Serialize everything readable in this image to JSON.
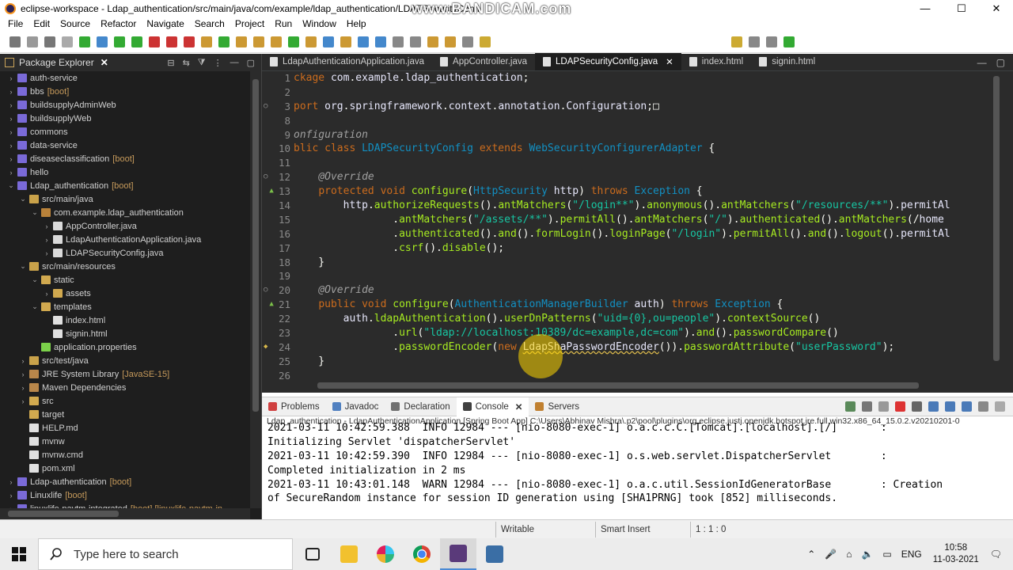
{
  "window": {
    "title": "eclipse-workspace - Ldap_authentication/src/main/java/com/example/ldap_authentication/LDAPSecurityConfi",
    "watermark": "www.BANDICAM.com",
    "controls": {
      "minimize": "—",
      "maximize": "☐",
      "close": "✕"
    }
  },
  "menu": [
    "File",
    "Edit",
    "Source",
    "Refactor",
    "Navigate",
    "Search",
    "Project",
    "Run",
    "Window",
    "Help"
  ],
  "explorer": {
    "title": "Package Explorer",
    "items": [
      {
        "label": "auth-service",
        "suffix": "",
        "depth": 0,
        "arrow": "›",
        "icon": "project-icon"
      },
      {
        "label": "bbs",
        "suffix": "[boot]",
        "depth": 0,
        "arrow": "›",
        "icon": "project-icon"
      },
      {
        "label": "buildsupplyAdminWeb",
        "suffix": "",
        "depth": 0,
        "arrow": "›",
        "icon": "project-icon"
      },
      {
        "label": "buildsupplyWeb",
        "suffix": "",
        "depth": 0,
        "arrow": "›",
        "icon": "project-icon"
      },
      {
        "label": "commons",
        "suffix": "",
        "depth": 0,
        "arrow": "›",
        "icon": "project-icon"
      },
      {
        "label": "data-service",
        "suffix": "",
        "depth": 0,
        "arrow": "›",
        "icon": "project-icon"
      },
      {
        "label": "diseaseclassification",
        "suffix": "[boot]",
        "depth": 0,
        "arrow": "›",
        "icon": "project-icon"
      },
      {
        "label": "hello",
        "suffix": "",
        "depth": 0,
        "arrow": "›",
        "icon": "project-icon"
      },
      {
        "label": "Ldap_authentication",
        "suffix": "[boot]",
        "depth": 0,
        "arrow": "⌄",
        "icon": "project-icon"
      },
      {
        "label": "src/main/java",
        "suffix": "",
        "depth": 1,
        "arrow": "⌄",
        "icon": "source-folder-icon"
      },
      {
        "label": "com.example.ldap_authentication",
        "suffix": "",
        "depth": 2,
        "arrow": "⌄",
        "icon": "package-icon"
      },
      {
        "label": "AppController.java",
        "suffix": "",
        "depth": 3,
        "arrow": "›",
        "icon": "java-file-icon"
      },
      {
        "label": "LdapAuthenticationApplication.java",
        "suffix": "",
        "depth": 3,
        "arrow": "›",
        "icon": "java-file-icon"
      },
      {
        "label": "LDAPSecurityConfig.java",
        "suffix": "",
        "depth": 3,
        "arrow": "›",
        "icon": "java-file-icon"
      },
      {
        "label": "src/main/resources",
        "suffix": "",
        "depth": 1,
        "arrow": "⌄",
        "icon": "source-folder-icon"
      },
      {
        "label": "static",
        "suffix": "",
        "depth": 2,
        "arrow": "⌄",
        "icon": "folder-icon"
      },
      {
        "label": "assets",
        "suffix": "",
        "depth": 3,
        "arrow": "›",
        "icon": "folder-icon"
      },
      {
        "label": "templates",
        "suffix": "",
        "depth": 2,
        "arrow": "⌄",
        "icon": "folder-icon"
      },
      {
        "label": "index.html",
        "suffix": "",
        "depth": 3,
        "arrow": "",
        "icon": "html-file-icon"
      },
      {
        "label": "signin.html",
        "suffix": "",
        "depth": 3,
        "arrow": "",
        "icon": "html-file-icon"
      },
      {
        "label": "application.properties",
        "suffix": "",
        "depth": 2,
        "arrow": "",
        "icon": "properties-file-icon"
      },
      {
        "label": "src/test/java",
        "suffix": "",
        "depth": 1,
        "arrow": "›",
        "icon": "source-folder-icon"
      },
      {
        "label": "JRE System Library",
        "suffix": "[JavaSE-15]",
        "depth": 1,
        "arrow": "›",
        "icon": "library-icon"
      },
      {
        "label": "Maven Dependencies",
        "suffix": "",
        "depth": 1,
        "arrow": "›",
        "icon": "library-icon"
      },
      {
        "label": "src",
        "suffix": "",
        "depth": 1,
        "arrow": "›",
        "icon": "folder-icon"
      },
      {
        "label": "target",
        "suffix": "",
        "depth": 1,
        "arrow": "",
        "icon": "folder-icon"
      },
      {
        "label": "HELP.md",
        "suffix": "",
        "depth": 1,
        "arrow": "",
        "icon": "file-icon"
      },
      {
        "label": "mvnw",
        "suffix": "",
        "depth": 1,
        "arrow": "",
        "icon": "file-icon"
      },
      {
        "label": "mvnw.cmd",
        "suffix": "",
        "depth": 1,
        "arrow": "",
        "icon": "file-icon"
      },
      {
        "label": "pom.xml",
        "suffix": "",
        "depth": 1,
        "arrow": "",
        "icon": "xml-file-icon"
      },
      {
        "label": "Ldap-authentication",
        "suffix": "[boot]",
        "depth": 0,
        "arrow": "›",
        "icon": "project-icon"
      },
      {
        "label": "Linuxlife",
        "suffix": "[boot]",
        "depth": 0,
        "arrow": "›",
        "icon": "project-icon"
      },
      {
        "label": "linuxlife-paytm-integrated",
        "suffix": "[boot] [linuxlife-paytm-in",
        "depth": 0,
        "arrow": "›",
        "icon": "project-icon"
      }
    ]
  },
  "editor": {
    "tabs": [
      {
        "label": "LdapAuthenticationApplication.java",
        "active": false
      },
      {
        "label": "AppController.java",
        "active": false
      },
      {
        "label": "LDAPSecurityConfig.java",
        "active": true
      },
      {
        "label": "index.html",
        "active": false
      },
      {
        "label": "signin.html",
        "active": false
      }
    ],
    "lines": [
      {
        "n": "1",
        "marker": "",
        "text": "ckage com.example.ldap_authentication;"
      },
      {
        "n": "2",
        "marker": "",
        "text": ""
      },
      {
        "n": "3",
        "marker": "fold",
        "text": "port org.springframework.context.annotation.Configuration;□"
      },
      {
        "n": "8",
        "marker": "",
        "text": ""
      },
      {
        "n": "9",
        "marker": "",
        "text": "onfiguration"
      },
      {
        "n": "10",
        "marker": "",
        "text": "blic class LDAPSecurityConfig extends WebSecurityConfigurerAdapter {"
      },
      {
        "n": "11",
        "marker": "",
        "text": ""
      },
      {
        "n": "12",
        "marker": "fold",
        "text": "    @Override"
      },
      {
        "n": "13",
        "marker": "override",
        "text": "    protected void configure(HttpSecurity http) throws Exception {"
      },
      {
        "n": "14",
        "marker": "",
        "text": "        http.authorizeRequests().antMatchers(\"/login**\").anonymous().antMatchers(\"/resources/**\").permitAl"
      },
      {
        "n": "15",
        "marker": "",
        "text": "                .antMatchers(\"/assets/**\").permitAll().antMatchers(\"/\").authenticated().antMatchers(\"/home"
      },
      {
        "n": "16",
        "marker": "",
        "text": "                .authenticated().and().formLogin().loginPage(\"/login\").permitAll().and().logout().permitAl"
      },
      {
        "n": "17",
        "marker": "",
        "text": "                .csrf().disable();"
      },
      {
        "n": "18",
        "marker": "",
        "text": "    }"
      },
      {
        "n": "19",
        "marker": "",
        "text": ""
      },
      {
        "n": "20",
        "marker": "fold",
        "text": "    @Override"
      },
      {
        "n": "21",
        "marker": "override",
        "text": "    public void configure(AuthenticationManagerBuilder auth) throws Exception {"
      },
      {
        "n": "22",
        "marker": "",
        "text": "        auth.ldapAuthentication().userDnPatterns(\"uid={0},ou=people\").contextSource()"
      },
      {
        "n": "23",
        "marker": "",
        "text": "                .url(\"ldap://localhost:10389/dc=example,dc=com\").and().passwordCompare()"
      },
      {
        "n": "24",
        "marker": "warning",
        "text": "                .passwordEncoder(new LdapShaPasswordEncoder()).passwordAttribute(\"userPassword\");"
      },
      {
        "n": "25",
        "marker": "",
        "text": "    }"
      },
      {
        "n": "26",
        "marker": "",
        "text": ""
      }
    ]
  },
  "console": {
    "tabs": [
      {
        "label": "Problems",
        "icon": "problems-icon"
      },
      {
        "label": "Javadoc",
        "icon": "javadoc-icon"
      },
      {
        "label": "Declaration",
        "icon": "declaration-icon"
      },
      {
        "label": "Console",
        "icon": "console-icon"
      },
      {
        "label": "Servers",
        "icon": "servers-icon"
      }
    ],
    "active_tab": "Console",
    "description": "Ldap_authentication - LdapAuthenticationApplication [Spring Boot App] C:\\Users\\Abhinav Mishra\\.p2\\pool\\plugins\\org.eclipse.justj.openjdk.hotspot.jre.full.win32.x86_64_15.0.2.v20210201-0",
    "lines": [
      "2021-03-11 10:42:59.388  INFO 12984 --- [nio-8080-exec-1] o.a.c.c.C.[Tomcat].[localhost].[/]       :",
      "Initializing Servlet 'dispatcherServlet'",
      "2021-03-11 10:42:59.390  INFO 12984 --- [nio-8080-exec-1] o.s.web.servlet.DispatcherServlet        :",
      "Completed initialization in 2 ms",
      "2021-03-11 10:43:01.148  WARN 12984 --- [nio-8080-exec-1] o.a.c.util.SessionIdGeneratorBase        : Creation",
      "of SecureRandom instance for session ID generation using [SHA1PRNG] took [852] milliseconds."
    ]
  },
  "status": {
    "writable": "Writable",
    "insert_mode": "Smart Insert",
    "position": "1 : 1 : 0"
  },
  "taskbar": {
    "search_placeholder": "Type here to search",
    "language": "ENG",
    "time": "10:58",
    "date": "11-03-2021"
  }
}
